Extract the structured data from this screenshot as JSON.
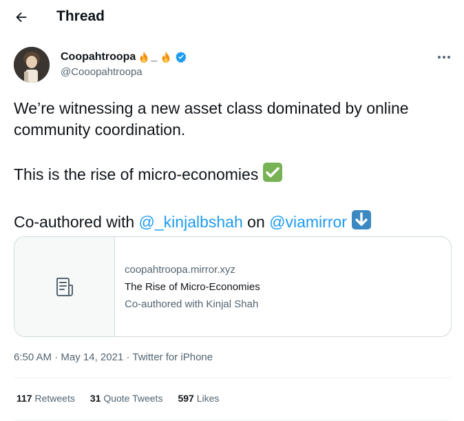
{
  "header": {
    "title": "Thread"
  },
  "author": {
    "display_name": "Coopahtroopa",
    "name_separator": "_",
    "handle": "@Cooopahtroopa",
    "verified": true
  },
  "tweet": {
    "line1": "We’re witnessing a new asset class dominated by online community coordination.",
    "line2": "This is the rise of micro-economies",
    "line3_prefix": "Co-authored with ",
    "mention1": "@_kinjalbshah",
    "line3_middle": " on ",
    "mention2": "@viamirror"
  },
  "card": {
    "domain": "coopahtroopa.mirror.xyz",
    "title": "The Rise of Micro-Economies",
    "description": "Co-authored with Kinjal Shah",
    "thumb_icon": "document-icon"
  },
  "meta": {
    "time": "6:50 AM",
    "separator": "·",
    "date": "May 14, 2021",
    "source": "Twitter for iPhone"
  },
  "stats": {
    "retweets_count": "117",
    "retweets_label": "Retweets",
    "quotes_count": "31",
    "quotes_label": "Quote Tweets",
    "likes_count": "597",
    "likes_label": "Likes"
  },
  "colors": {
    "accent": "#1d9bf0",
    "text": "#0f1419",
    "muted": "#536471",
    "border": "#cfd9de"
  }
}
